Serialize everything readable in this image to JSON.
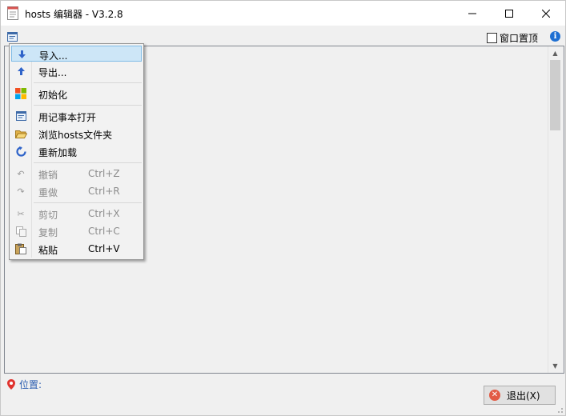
{
  "window": {
    "title": "hosts 编辑器 - V3.2.8"
  },
  "toolbar": {
    "topmost_label": "窗口置顶"
  },
  "status": {
    "location_label": "位置:"
  },
  "footer": {
    "exit_label": "退出(X)"
  },
  "menu": {
    "items": [
      {
        "label": "导入...",
        "shortcut": "",
        "icon": "import-arrow-icon"
      },
      {
        "label": "导出...",
        "shortcut": "",
        "icon": "export-arrow-icon"
      },
      {
        "label": "初始化",
        "shortcut": "",
        "icon": "windows-logo-icon"
      },
      {
        "label": "用记事本打开",
        "shortcut": "",
        "icon": "notepad-icon"
      },
      {
        "label": "浏览hosts文件夹",
        "shortcut": "",
        "icon": "folder-open-icon"
      },
      {
        "label": "重新加载",
        "shortcut": "",
        "icon": "reload-icon"
      },
      {
        "label": "撤销",
        "shortcut": "Ctrl+Z",
        "icon": "undo-icon"
      },
      {
        "label": "重做",
        "shortcut": "Ctrl+R",
        "icon": "redo-icon"
      },
      {
        "label": "剪切",
        "shortcut": "Ctrl+X",
        "icon": "cut-icon"
      },
      {
        "label": "复制",
        "shortcut": "Ctrl+C",
        "icon": "copy-icon"
      },
      {
        "label": "粘贴",
        "shortcut": "Ctrl+V",
        "icon": "paste-icon"
      }
    ]
  },
  "colors": {
    "selection": "#cde6f7",
    "accent": "#1e6fd2",
    "disabled_text": "#8c8c8c"
  }
}
